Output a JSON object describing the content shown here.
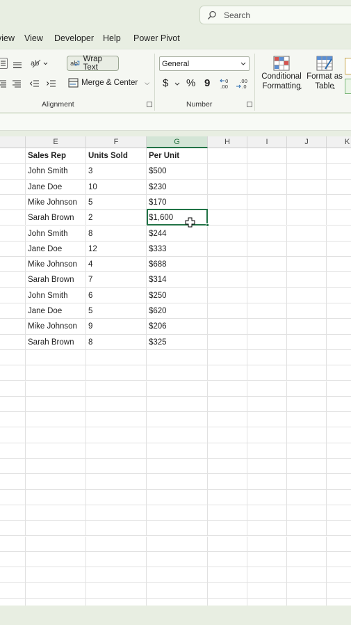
{
  "search": {
    "placeholder": "Search"
  },
  "tabs": [
    "view",
    "View",
    "Developer",
    "Help",
    "Power Pivot"
  ],
  "ribbon": {
    "wrap_text": "Wrap Text",
    "merge_center": "Merge & Center",
    "number_format": "General",
    "currency_symbol": "$",
    "percent_symbol": "%",
    "comma_symbol": "9",
    "cond_format_line1": "Conditional",
    "cond_format_line2": "Formatting",
    "format_table_line1": "Format as",
    "format_table_line2": "Table",
    "group_alignment": "Alignment",
    "group_number": "Number"
  },
  "columns": [
    "E",
    "F",
    "G",
    "H",
    "I",
    "J",
    "K"
  ],
  "selected_column": "G",
  "table": {
    "headers": [
      "Sales Rep",
      "Units Sold",
      "Per Unit"
    ],
    "rows": [
      [
        "John Smith",
        "3",
        "$500"
      ],
      [
        "Jane Doe",
        "10",
        "$230"
      ],
      [
        "Mike Johnson",
        "5",
        "$170"
      ],
      [
        "Sarah Brown",
        "2",
        "$1,600"
      ],
      [
        "John Smith",
        "8",
        "$244"
      ],
      [
        "Jane Doe",
        "12",
        "$333"
      ],
      [
        "Mike Johnson",
        "4",
        "$688"
      ],
      [
        "Sarah Brown",
        "7",
        "$314"
      ],
      [
        "John Smith",
        "6",
        "$250"
      ],
      [
        "Jane Doe",
        "5",
        "$620"
      ],
      [
        "Mike Johnson",
        "9",
        "$206"
      ],
      [
        "Sarah Brown",
        "8",
        "$325"
      ]
    ]
  },
  "active_cell": "G5",
  "colors": {
    "accent": "#217346",
    "ribbon_bg": "#f5f7f2",
    "chrome_bg": "#e8eee2"
  }
}
